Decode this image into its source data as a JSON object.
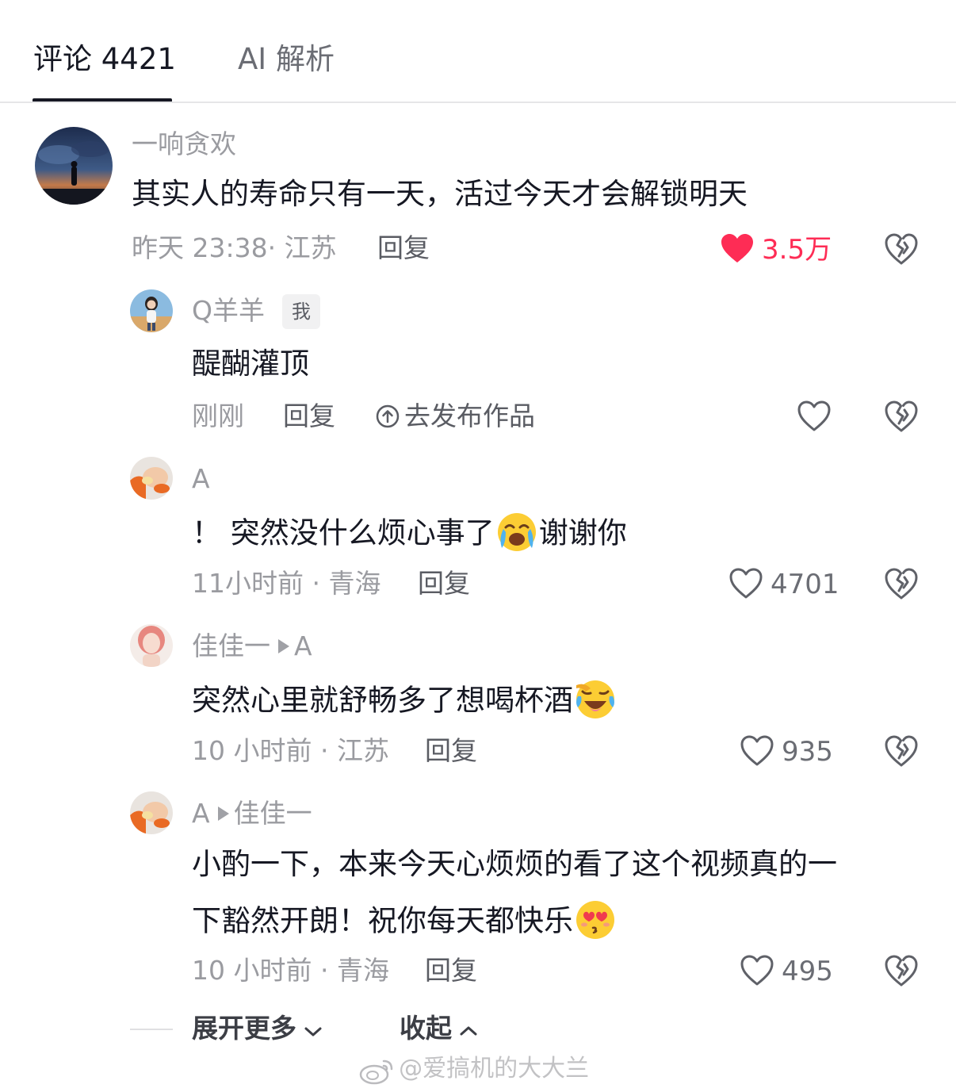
{
  "tabs": {
    "comments_label": "评论 4421",
    "ai_label": "AI 解析"
  },
  "colors": {
    "liked": "#fe2c55",
    "text_primary": "#161823",
    "text_secondary": "#9a9ba0"
  },
  "comment": {
    "username": "一响贪欢",
    "text": "其实人的寿命只有一天，活过今天才会解锁明天",
    "meta": "昨天 23:38· 江苏",
    "reply_label": "回复",
    "like_count": "3.5万",
    "liked": true,
    "icons": [
      "heart-filled-icon",
      "broken-heart-icon"
    ],
    "replies": [
      {
        "username": "Q羊羊",
        "badge": "我",
        "text": "醍醐灌顶",
        "meta": "刚刚",
        "reply_label": "回复",
        "publish_label": "去发布作品",
        "icons": [
          "upload-circle-icon",
          "heart-outline-icon",
          "broken-heart-icon"
        ]
      },
      {
        "username": "A",
        "text_before_emoji": "！ 突然没什么烦心事了",
        "text_after_emoji": "谢谢你",
        "emoji": "crying-face-emoji",
        "meta": "11小时前 · 青海",
        "reply_label": "回复",
        "like_count": "4701"
      },
      {
        "username": "佳佳一",
        "reply_to": "A",
        "text": "突然心里就舒畅多了想喝杯酒",
        "emoji": "laughing-crying-face-emoji",
        "meta": "10 小时前 · 江苏",
        "reply_label": "回复",
        "like_count": "935"
      },
      {
        "username": "A",
        "reply_to": "佳佳一",
        "text_line1": "小酌一下，本来今天心烦烦的看了这个视频真的一",
        "text_line2": "下豁然开朗！祝你每天都快乐",
        "emoji": "kissing-heart-face-emoji",
        "meta": "10 小时前 · 青海",
        "reply_label": "回复",
        "like_count": "495"
      }
    ]
  },
  "footer": {
    "expand_label": "展开更多",
    "collapse_label": "收起"
  },
  "watermark": {
    "text": "@爱搞机的大大兰",
    "icon": "weibo-icon"
  }
}
